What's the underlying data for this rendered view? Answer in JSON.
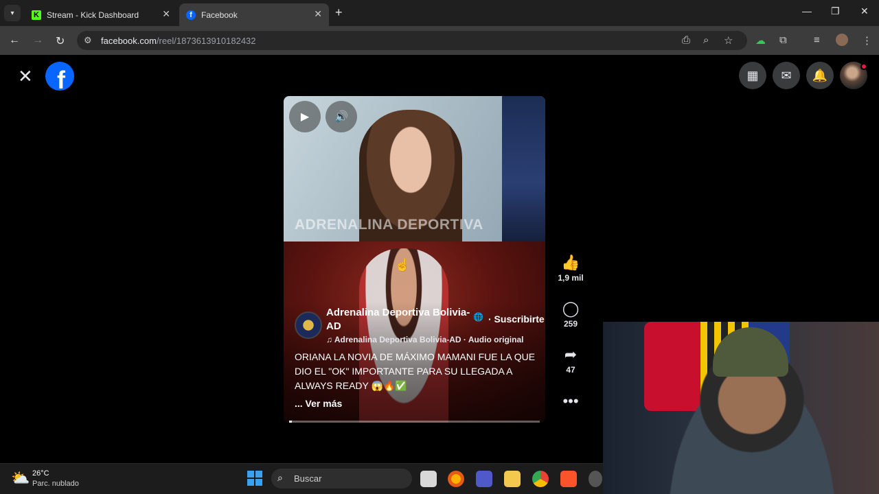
{
  "browser": {
    "tabs": [
      {
        "title": "Stream - Kick Dashboard",
        "favicon": "K"
      },
      {
        "title": "Facebook",
        "favicon": "f"
      }
    ],
    "new_tab": "+",
    "url_host": "facebook.com",
    "url_path": "/reel/1873613910182432"
  },
  "facebook": {
    "logo": "f"
  },
  "reel": {
    "watermark": "ADRENALINA DEPORTIVA",
    "page_name": "Adrenalina Deportiva Bolivia-AD",
    "subscribe_label": "· Suscribirte",
    "audio": "♫ Adrenalina Deportiva Bolivia-AD · Audio original",
    "caption": "ORIANA LA NOVIA DE MÁXIMO MAMANI FUE LA QUE DIO EL \"OK\" IMPORTANTE PARA SU LLEGADA A ALWAYS READY 😱🔥✅",
    "see_more": "... Ver más",
    "progress": 0.01,
    "likes": "1,9 mil",
    "comments": "259",
    "shares": "47"
  },
  "taskbar": {
    "temperature": "26°C",
    "condition": "Parc. nublado",
    "search_placeholder": "Buscar"
  },
  "colors": {
    "facebook_blue": "#0866ff",
    "notification_red": "#e41e3f",
    "kick_green": "#53fc18"
  }
}
